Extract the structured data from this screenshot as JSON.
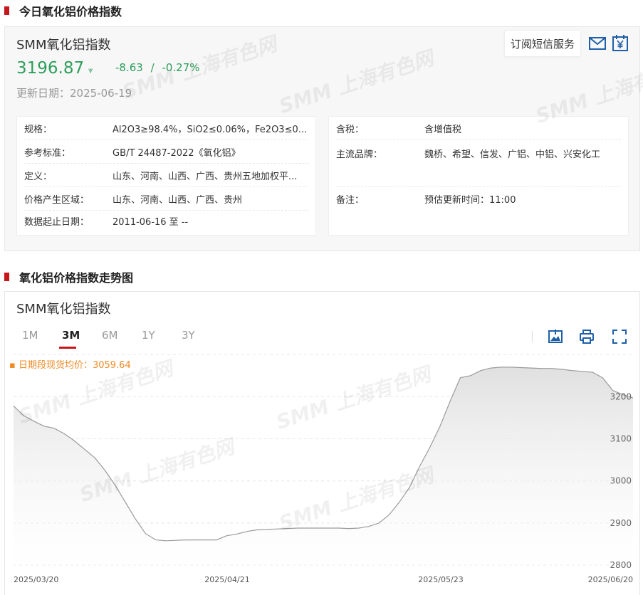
{
  "section1": {
    "title": "今日氧化铝价格指数"
  },
  "index": {
    "name": "SMM氧化铝指数",
    "value": "3196.87",
    "change": "-8.63",
    "change_sep": "/",
    "change_pct": "-0.27%",
    "date_label": "更新日期：",
    "date": "2025-06-19",
    "subscribe_label": "订阅短信服务",
    "icons": [
      "mail-icon",
      "currency-yuan-icon"
    ]
  },
  "spec_left": [
    {
      "k": "规格：",
      "v": "Al2O3≥98.4%，SiO2≤0.06%，Fe2O3≤0..."
    },
    {
      "k": "参考标准：",
      "v": "GB/T 24487-2022《氧化铝》"
    },
    {
      "k": "定义：",
      "v": "山东、河南、山西、广西、贵州五地加权平..."
    },
    {
      "k": "价格产生区域：",
      "v": "山东、河南、山西、广西、贵州"
    },
    {
      "k": "数据起止日期：",
      "v": "2011-06-16 至 --"
    }
  ],
  "spec_right": [
    {
      "k": "含税：",
      "v": "含增值税"
    },
    {
      "k": "主流品牌：",
      "v": "魏桥、希望、信发、广铝、中铝、兴安化工"
    },
    {
      "k": "备注：",
      "v": "预估更新时间：11:00"
    }
  ],
  "section2": {
    "title": "氧化铝价格指数走势图"
  },
  "chart_panel": {
    "title": "SMM氧化铝指数",
    "tabs": [
      "1M",
      "3M",
      "6M",
      "1Y",
      "3Y"
    ],
    "active_tab": "3M",
    "avg_label": "日期段现货均价：3059.64",
    "tools": [
      "download-image-icon",
      "print-icon",
      "fullscreen-icon"
    ]
  },
  "watermark": "SMM 上海有色网",
  "chart_data": {
    "type": "area",
    "series": [
      {
        "values": [
          3178,
          3155,
          3142,
          3130,
          3125,
          3112,
          3095,
          3075,
          3055,
          3025,
          2990,
          2950,
          2910,
          2875,
          2860,
          2858,
          2859,
          2860,
          2860,
          2860,
          2860,
          2870,
          2874,
          2880,
          2884,
          2885,
          2886,
          2887,
          2888,
          2888,
          2888,
          2888,
          2888,
          2887,
          2888,
          2892,
          2900,
          2920,
          2950,
          2985,
          3035,
          3080,
          3130,
          3190,
          3245,
          3250,
          3262,
          3268,
          3270,
          3270,
          3269,
          3268,
          3267,
          3267,
          3265,
          3262,
          3260,
          3258,
          3245,
          3215,
          3205,
          3196.87
        ]
      }
    ],
    "x_ticks": [
      "2025/03/20",
      "2025/04/21",
      "2025/05/23",
      "2025/06/20"
    ],
    "y_ticks": [
      2800,
      2900,
      3000,
      3100,
      3200
    ],
    "ylim": [
      2790,
      3280
    ],
    "ylabel_position": "right",
    "line_color": "#9a9a9a",
    "fill_color": "#e0e0e0",
    "avg_color": "#f08a24",
    "grid": true
  }
}
